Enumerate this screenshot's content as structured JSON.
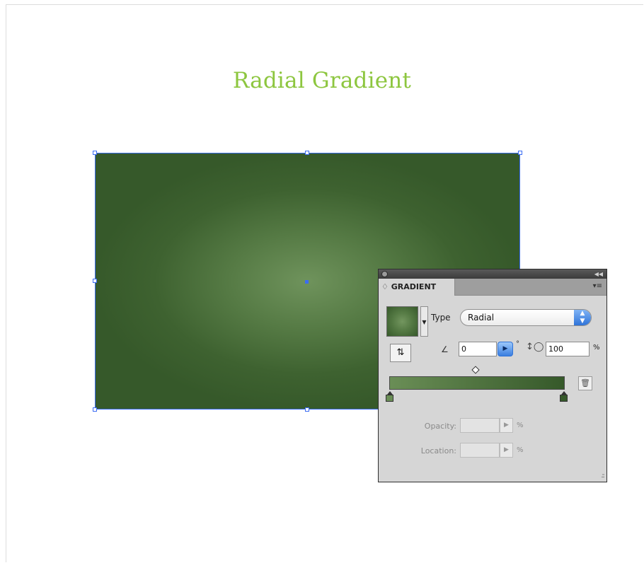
{
  "heading": "Radial Gradient",
  "colors": {
    "title": "#8dc63f",
    "gradient_center": "#73965f",
    "gradient_edge": "#36592a",
    "selection": "#3b6cf3"
  },
  "panel": {
    "tab_label": "♢ GRADIENT",
    "type_label": "Type",
    "type_value": "Radial",
    "angle_value": "0",
    "degree_symbol": "°",
    "aspect_value": "100",
    "aspect_unit": "%",
    "opacity_label": "Opacity:",
    "location_label": "Location:",
    "opacity_unit": "%",
    "location_unit": "%",
    "stops": [
      {
        "color": "#6a8e56",
        "location_pct": 0
      },
      {
        "color": "#36592a",
        "location_pct": 100
      }
    ],
    "midpoint_pct": 50
  },
  "icons": {
    "close": "close-dot-icon",
    "collapse": "collapse-arrows-icon",
    "menu": "panel-menu-icon",
    "reverse": "reverse-gradient-icon",
    "angle": "angle-icon",
    "aspect": "aspect-ratio-icon",
    "trash": "delete-stop-icon"
  }
}
